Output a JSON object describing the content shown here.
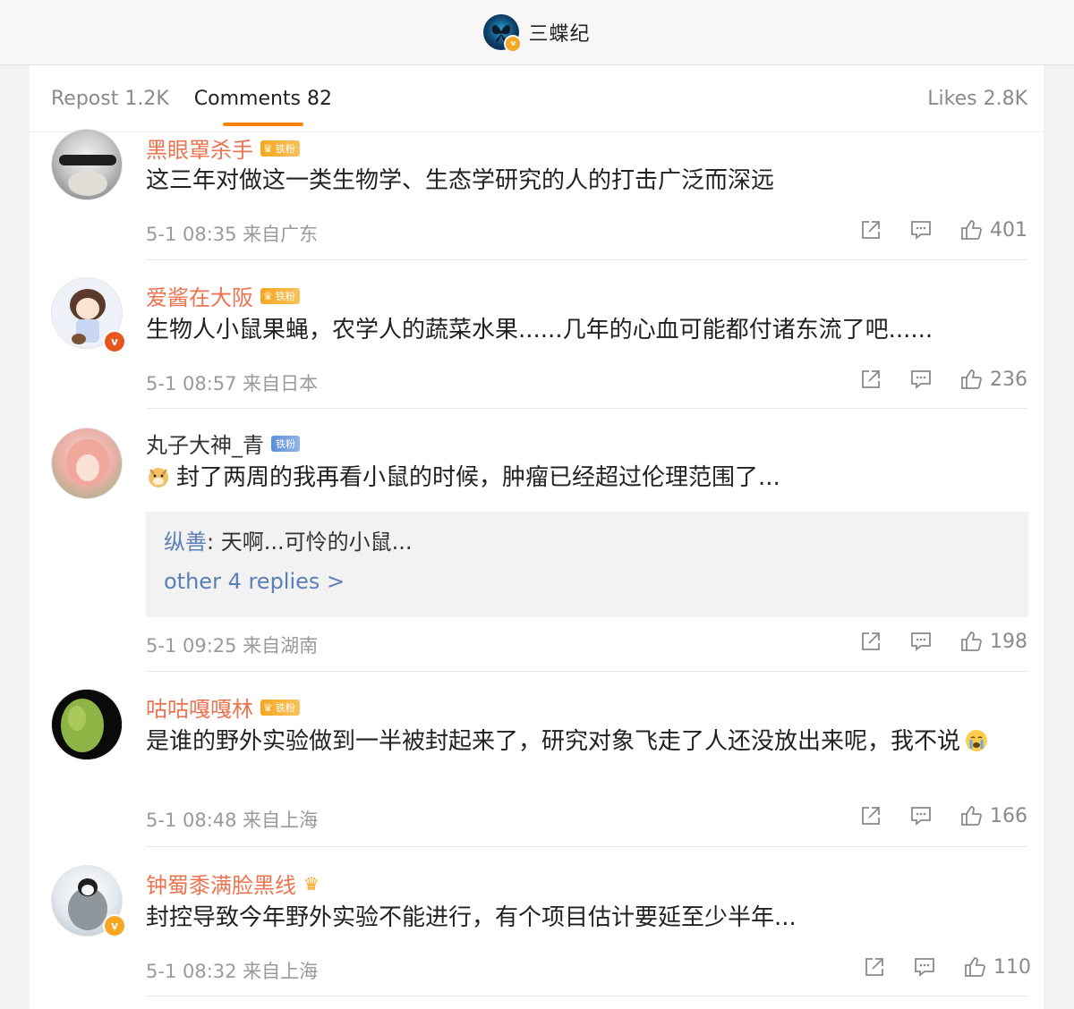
{
  "header": {
    "title": "三蝶纪",
    "badge": "v"
  },
  "tabs": {
    "repost": "Repost 1.2K",
    "comments": "Comments 82",
    "likes": "Likes 2.8K"
  },
  "fan_badge": "铁粉",
  "comments": [
    {
      "name": "黑眼罩杀手",
      "text": "这三年对做这一类生物学、生态学研究的人的打击广泛而深远",
      "time": "5-1 08:35 来自广东",
      "likes": "401"
    },
    {
      "name": "爱酱在大阪",
      "text": "生物人小鼠果蝇，农学人的蔬菜水果......几年的心血可能都付诸东流了吧......",
      "time": "5-1 08:57 来自日本",
      "likes": "236",
      "verified": "v"
    },
    {
      "name": "丸子大神_青",
      "text": "封了两周的我再看小鼠的时候，肿瘤已经超过伦理范围了...",
      "time": "5-1 09:25 来自湖南",
      "likes": "198",
      "reply": {
        "name": "纵善",
        "text": ": 天啊...可怜的小鼠...",
        "more": "other 4 replies >"
      }
    },
    {
      "name": "咕咕嘎嘎林",
      "text": "是谁的野外实验做到一半被封起来了，研究对象飞走了人还没放出来呢，我不说",
      "time": "5-1 08:48 来自上海",
      "likes": "166"
    },
    {
      "name": "钟蜀黍满脸黑线",
      "text": "封控导致今年野外实验不能进行，有个项目估计要延至少半年...",
      "time": "5-1 08:32 来自上海",
      "likes": "110",
      "verified": "v"
    }
  ],
  "icons": [
    "share-icon",
    "comment-icon",
    "like-icon",
    "crown-icon",
    "emoji-dog-icon",
    "emoji-crying-icon"
  ]
}
